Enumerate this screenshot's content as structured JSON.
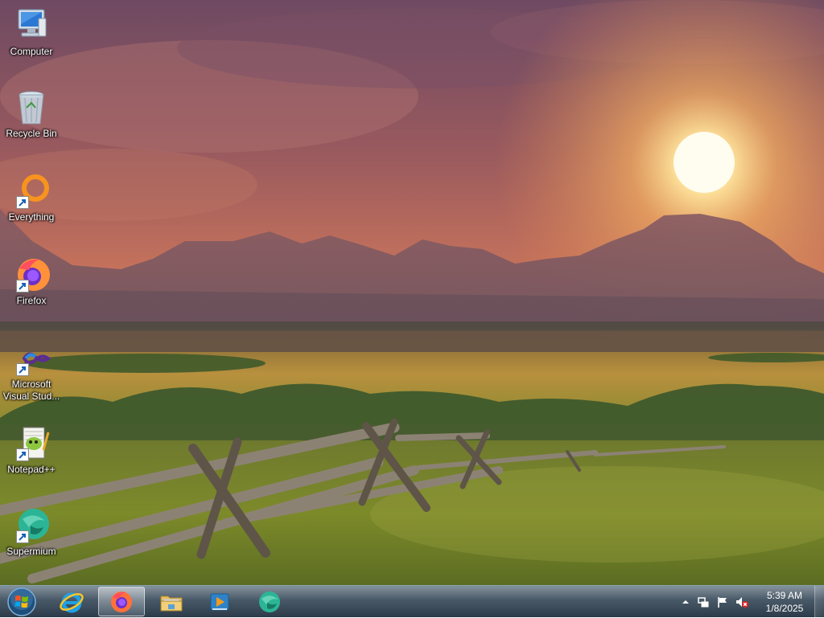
{
  "desktop": {
    "icons": [
      {
        "label": "Computer",
        "icon": "computer-icon",
        "shortcut": false
      },
      {
        "label": "Recycle Bin",
        "icon": "recycle-bin-icon",
        "shortcut": false
      },
      {
        "label": "Everything",
        "icon": "everything-search-icon",
        "shortcut": true
      },
      {
        "label": "Firefox",
        "icon": "firefox-icon",
        "shortcut": true
      },
      {
        "label": "Microsoft Visual Stud...",
        "icon": "visual-studio-icon",
        "shortcut": true
      },
      {
        "label": "Notepad++",
        "icon": "notepad-plus-plus-icon",
        "shortcut": true
      },
      {
        "label": "Supermium",
        "icon": "supermium-icon",
        "shortcut": true
      }
    ]
  },
  "taskbar": {
    "start_icon": "windows-start-orb-icon",
    "pinned": [
      {
        "name": "Internet Explorer",
        "icon": "internet-explorer-icon",
        "active": false
      },
      {
        "name": "Firefox",
        "icon": "firefox-icon",
        "active": true
      },
      {
        "name": "Windows Explorer",
        "icon": "file-explorer-icon",
        "active": false
      },
      {
        "name": "Windows Media Player",
        "icon": "media-player-icon",
        "active": false
      },
      {
        "name": "Supermium",
        "icon": "supermium-icon",
        "active": false
      }
    ],
    "tray": {
      "icons": [
        "show-hidden-icons-chevron-icon",
        "network-icon",
        "action-center-flag-icon",
        "volume-muted-icon"
      ],
      "time": "5:39 AM",
      "date": "1/8/2025"
    }
  },
  "colors": {
    "firefox_orange": "#ff7139",
    "everything_orange": "#f7931e",
    "supermium_teal": "#2bb596",
    "taskbar": "#3a5468"
  }
}
